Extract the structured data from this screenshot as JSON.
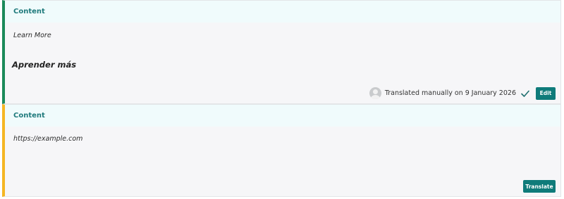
{
  "blocks": [
    {
      "title": "Content",
      "source_text": "Learn More",
      "translation": "Aprender más",
      "status_text": "Translated manually on 9 January 2026",
      "action_label": "Edit",
      "accent_color": "#1b8a5a"
    },
    {
      "title": "Content",
      "source_text": "https://example.com",
      "action_label": "Translate",
      "accent_color": "#f5b623"
    }
  ],
  "colors": {
    "header_bg": "#f0fbfc",
    "title_text": "#1f7a7c",
    "button_bg": "#0f7b7a",
    "block_bg": "#f6f6f8"
  },
  "icons": {
    "avatar": "user-avatar-icon",
    "status": "checkmark-icon"
  }
}
